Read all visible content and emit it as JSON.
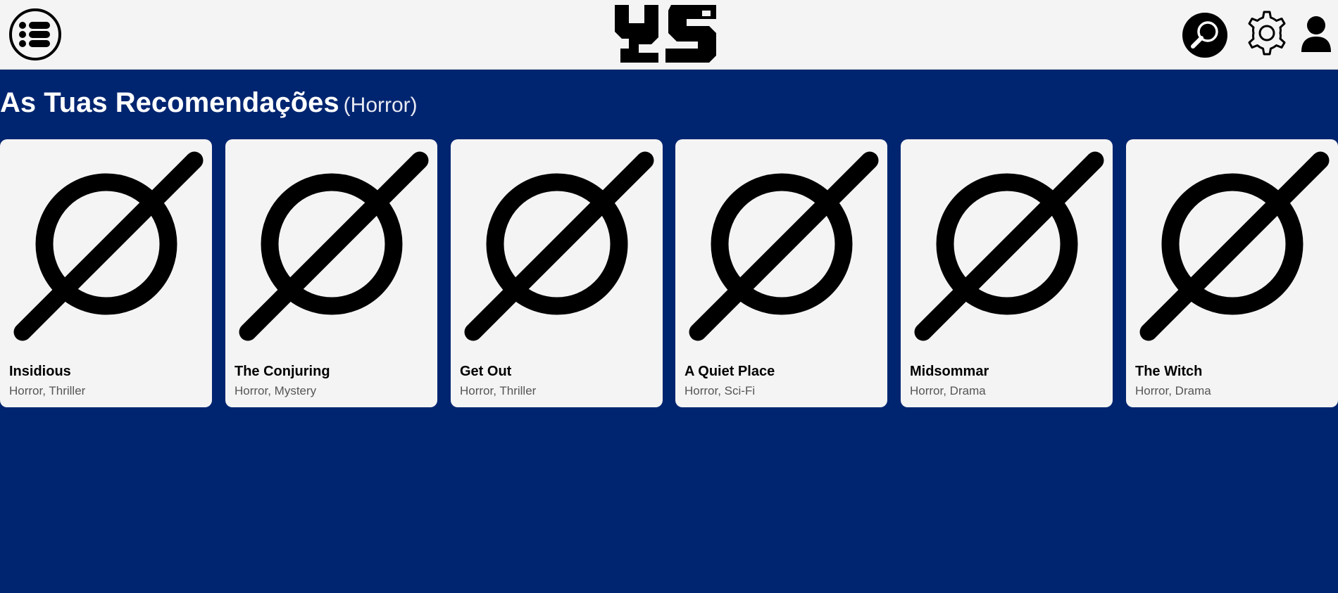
{
  "header": {
    "logo_text": "YS",
    "menu_icon": "list-icon",
    "search_icon": "search-icon",
    "settings_icon": "gear-icon",
    "profile_icon": "user-icon"
  },
  "section": {
    "title": "As Tuas Recomendações",
    "genre": "(Horror)"
  },
  "cards": [
    {
      "title": "Insidious",
      "genres": "Horror, Thriller",
      "poster_icon": "no-image-icon"
    },
    {
      "title": "The Conjuring",
      "genres": "Horror, Mystery",
      "poster_icon": "no-image-icon"
    },
    {
      "title": "Get Out",
      "genres": "Horror, Thriller",
      "poster_icon": "no-image-icon"
    },
    {
      "title": "A Quiet Place",
      "genres": "Horror, Sci-Fi",
      "poster_icon": "no-image-icon"
    },
    {
      "title": "Midsommar",
      "genres": "Horror, Drama",
      "poster_icon": "no-image-icon"
    },
    {
      "title": "The Witch",
      "genres": "Horror, Drama",
      "poster_icon": "no-image-icon"
    }
  ],
  "colors": {
    "background": "#002570",
    "header": "#f4f4f4",
    "card": "#f4f4f4"
  }
}
